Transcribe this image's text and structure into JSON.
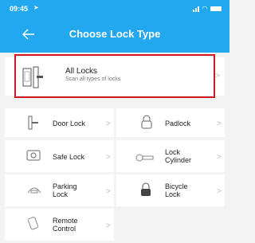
{
  "status_bar": {
    "time": "09:45"
  },
  "nav": {
    "title": "Choose Lock Type"
  },
  "all_locks": {
    "title": "All Locks",
    "subtitle": "Scan all types of locks"
  },
  "lock_types": [
    {
      "label": "Door Lock"
    },
    {
      "label": "Padlock"
    },
    {
      "label": "Safe Lock"
    },
    {
      "label": "Lock\nCylinder"
    },
    {
      "label": "Parking\nLock"
    },
    {
      "label": "Bicycle\nLock"
    },
    {
      "label": "Remote\nControl"
    }
  ],
  "colors": {
    "header": "#21a8ee",
    "highlight": "#d0161e",
    "background": "#f3f3f3"
  },
  "icons": {
    "back": "back-arrow-icon",
    "chevron": "chevron-right-icon"
  }
}
